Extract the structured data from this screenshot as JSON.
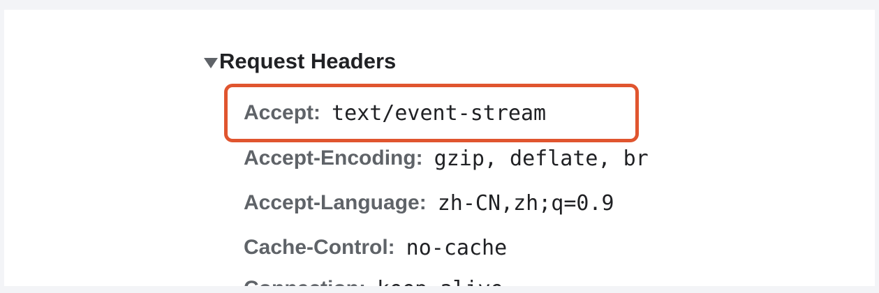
{
  "section": {
    "title": "Request Headers",
    "expanded": true
  },
  "headers": [
    {
      "name": "Accept:",
      "value": "text/event-stream"
    },
    {
      "name": "Accept-Encoding:",
      "value": "gzip, deflate, br"
    },
    {
      "name": "Accept-Language:",
      "value": "zh-CN,zh;q=0.9"
    },
    {
      "name": "Cache-Control:",
      "value": "no-cache"
    },
    {
      "name": "Connection:",
      "value": "keep-alive"
    }
  ],
  "highlight": {
    "color": "#e0552f"
  }
}
